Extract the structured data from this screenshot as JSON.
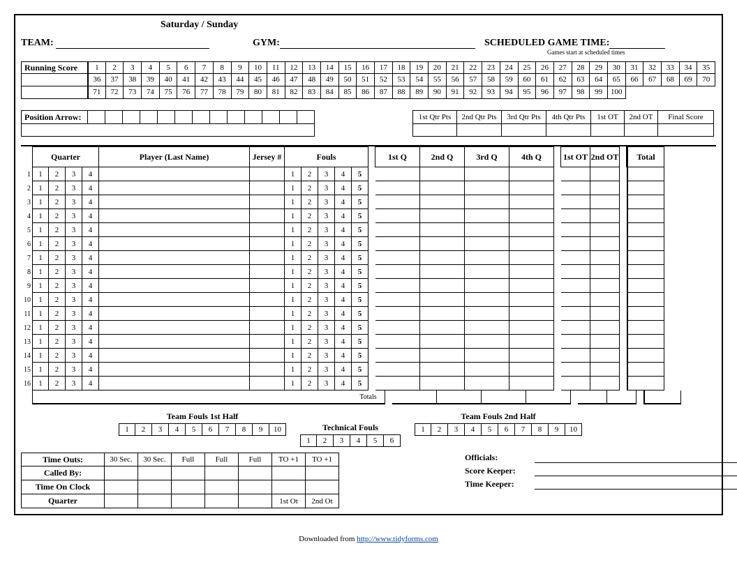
{
  "header": {
    "day_label": "Saturday   /   Sunday",
    "team_label": "TEAM",
    "gym_label": "GYM",
    "sched_label": "SCHEDULED GAME TIME",
    "sched_note": "Games start at scheduled times"
  },
  "running_score": {
    "label": "Running Score",
    "row1": [
      "1",
      "2",
      "3",
      "4",
      "5",
      "6",
      "7",
      "8",
      "9",
      "10",
      "11",
      "12",
      "13",
      "14",
      "15",
      "16",
      "17",
      "18",
      "19",
      "20",
      "21",
      "22",
      "23",
      "24",
      "25",
      "26",
      "27",
      "28",
      "29",
      "30",
      "31",
      "32",
      "33",
      "34",
      "35"
    ],
    "row2": [
      "36",
      "37",
      "38",
      "39",
      "40",
      "41",
      "42",
      "43",
      "44",
      "45",
      "46",
      "47",
      "48",
      "49",
      "50",
      "51",
      "52",
      "53",
      "54",
      "55",
      "56",
      "57",
      "58",
      "59",
      "60",
      "61",
      "62",
      "63",
      "64",
      "65",
      "66",
      "67",
      "68",
      "69",
      "70"
    ],
    "row3": [
      "71",
      "72",
      "73",
      "74",
      "75",
      "76",
      "77",
      "78",
      "79",
      "80",
      "81",
      "82",
      "83",
      "84",
      "85",
      "86",
      "87",
      "88",
      "89",
      "90",
      "91",
      "92",
      "93",
      "94",
      "95",
      "96",
      "97",
      "98",
      "99",
      "100",
      "",
      "",
      "",
      "",
      ""
    ]
  },
  "position_arrow": {
    "label": "Position Arrow:",
    "cells": 13
  },
  "quarter_pts": {
    "headers": [
      "1st Qtr Pts",
      "2nd Qtr Pts",
      "3rd Qtr Pts",
      "4th Qtr Pts",
      "1st OT",
      "2nd OT",
      "Final Score"
    ],
    "widths": [
      64,
      64,
      64,
      64,
      48,
      48,
      80
    ]
  },
  "roster": {
    "col_headers": {
      "quarter": "Quarter",
      "player": "Player (Last Name)",
      "jersey": "Jersey #",
      "fouls": "Fouls",
      "q1": "1st Q",
      "q2": "2nd Q",
      "q3": "3rd Q",
      "q4": "4th Q",
      "ot1": "1st OT",
      "ot2": "2nd OT",
      "total": "Total"
    },
    "rows": 16,
    "qtr_vals": [
      "1",
      "2",
      "3",
      "4"
    ],
    "foul_vals": [
      "1",
      "2",
      "3",
      "4",
      "5"
    ],
    "totals_label": "Totals"
  },
  "team_fouls": {
    "half1": "Team Fouls 1st Half",
    "half2": "Team Fouls 2nd Half",
    "nums10": [
      "1",
      "2",
      "3",
      "4",
      "5",
      "6",
      "7",
      "8",
      "9",
      "10"
    ],
    "tech_label": "Technical Fouls",
    "nums6": [
      "1",
      "2",
      "3",
      "4",
      "5",
      "6"
    ]
  },
  "timeouts": {
    "row_labels": [
      "Time Outs:",
      "Called By:",
      "Time On Clock",
      "Quarter"
    ],
    "cols": [
      "30 Sec.",
      "30 Sec.",
      "Full",
      "Full",
      "Full",
      "TO +1",
      "TO +1"
    ],
    "last_row_cols": [
      "",
      "",
      "",
      "",
      "",
      "1st Ot",
      "2nd Ot"
    ]
  },
  "officials": {
    "officials": "Officials:",
    "scorekeeper": "Score Keeper:",
    "timekeeper": "Time Keeper:"
  },
  "footer": {
    "prefix": "Downloaded from ",
    "url": "http://www.tidyforms.com"
  }
}
